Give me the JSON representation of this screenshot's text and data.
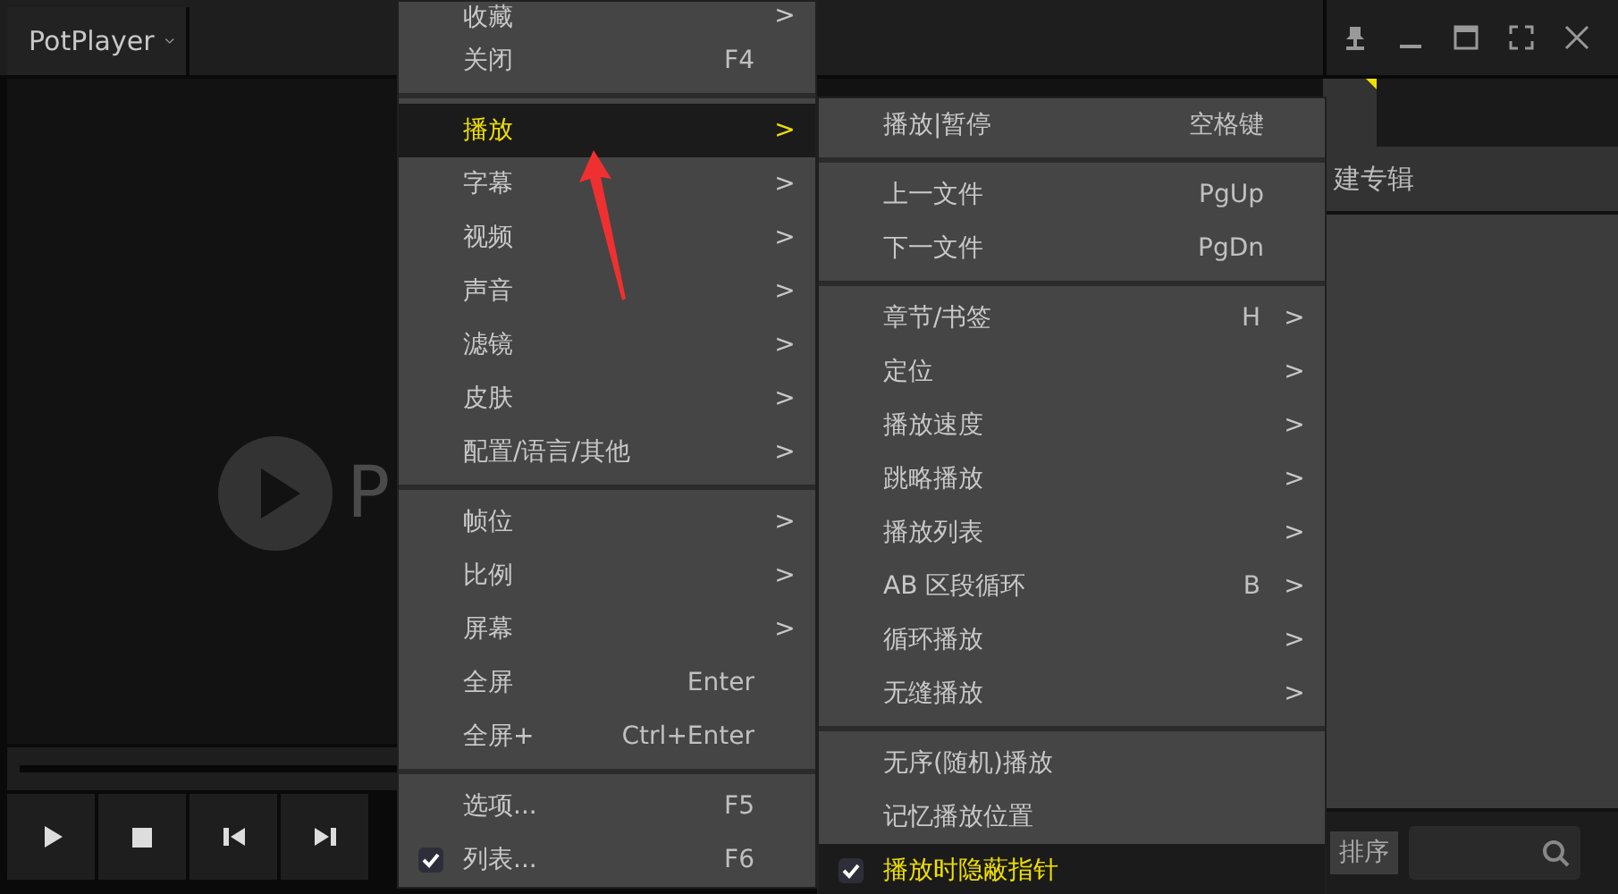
{
  "player": {
    "title": "PotPlayer",
    "logo_text": "P"
  },
  "main_menu": [
    {
      "kind": "item",
      "label": "收藏",
      "submenu": true,
      "selected": false,
      "checked": false
    },
    {
      "kind": "item",
      "label": "关闭",
      "shortcut": "F4",
      "submenu": false,
      "selected": false,
      "checked": false
    },
    {
      "kind": "separator"
    },
    {
      "kind": "item",
      "label": "播放",
      "submenu": true,
      "selected": true,
      "checked": false
    },
    {
      "kind": "item",
      "label": "字幕",
      "submenu": true,
      "selected": false,
      "checked": false
    },
    {
      "kind": "item",
      "label": "视频",
      "submenu": true,
      "selected": false,
      "checked": false
    },
    {
      "kind": "item",
      "label": "声音",
      "submenu": true,
      "selected": false,
      "checked": false
    },
    {
      "kind": "item",
      "label": "滤镜",
      "submenu": true,
      "selected": false,
      "checked": false
    },
    {
      "kind": "item",
      "label": "皮肤",
      "submenu": true,
      "selected": false,
      "checked": false
    },
    {
      "kind": "item",
      "label": "配置/语言/其他",
      "submenu": true,
      "selected": false,
      "checked": false
    },
    {
      "kind": "separator"
    },
    {
      "kind": "item",
      "label": "帧位",
      "submenu": true,
      "selected": false,
      "checked": false
    },
    {
      "kind": "item",
      "label": "比例",
      "submenu": true,
      "selected": false,
      "checked": false
    },
    {
      "kind": "item",
      "label": "屏幕",
      "submenu": true,
      "selected": false,
      "checked": false
    },
    {
      "kind": "item",
      "label": "全屏",
      "shortcut": "Enter",
      "submenu": false,
      "selected": false,
      "checked": false
    },
    {
      "kind": "item",
      "label": "全屏+",
      "shortcut": "Ctrl+Enter",
      "submenu": false,
      "selected": false,
      "checked": false
    },
    {
      "kind": "separator"
    },
    {
      "kind": "item",
      "label": "选项...",
      "shortcut": "F5",
      "submenu": false,
      "selected": false,
      "checked": false
    },
    {
      "kind": "item",
      "label": "列表...",
      "shortcut": "F6",
      "submenu": false,
      "selected": false,
      "checked": true
    }
  ],
  "play_submenu": [
    {
      "kind": "item",
      "label": "播放|暂停",
      "shortcut": "空格键",
      "submenu": false,
      "selected": false,
      "checked": false
    },
    {
      "kind": "separator"
    },
    {
      "kind": "item",
      "label": "上一文件",
      "shortcut": "PgUp",
      "submenu": false,
      "selected": false,
      "checked": false
    },
    {
      "kind": "item",
      "label": "下一文件",
      "shortcut": "PgDn",
      "submenu": false,
      "selected": false,
      "checked": false
    },
    {
      "kind": "separator"
    },
    {
      "kind": "item",
      "label": "章节/书签",
      "shortcut": "H",
      "submenu": true,
      "selected": false,
      "checked": false
    },
    {
      "kind": "item",
      "label": "定位",
      "submenu": true,
      "selected": false,
      "checked": false
    },
    {
      "kind": "item",
      "label": "播放速度",
      "submenu": true,
      "selected": false,
      "checked": false
    },
    {
      "kind": "item",
      "label": "跳略播放",
      "submenu": true,
      "selected": false,
      "checked": false
    },
    {
      "kind": "item",
      "label": "播放列表",
      "submenu": true,
      "selected": false,
      "checked": false
    },
    {
      "kind": "item",
      "label": "AB 区段循环",
      "shortcut": "B",
      "submenu": true,
      "selected": false,
      "checked": false
    },
    {
      "kind": "item",
      "label": "循环播放",
      "submenu": true,
      "selected": false,
      "checked": false
    },
    {
      "kind": "item",
      "label": "无缝播放",
      "submenu": true,
      "selected": false,
      "checked": false
    },
    {
      "kind": "separator"
    },
    {
      "kind": "item",
      "label": "无序(随机)播放",
      "submenu": false,
      "selected": false,
      "checked": false
    },
    {
      "kind": "item",
      "label": "记忆播放位置",
      "submenu": false,
      "selected": false,
      "checked": false
    },
    {
      "kind": "item",
      "label": "播放时隐蔽指针",
      "submenu": false,
      "selected": true,
      "checked": true
    }
  ],
  "submenu_arrow": ">",
  "playlist": {
    "header": "建专辑",
    "sort_button": "排序"
  }
}
